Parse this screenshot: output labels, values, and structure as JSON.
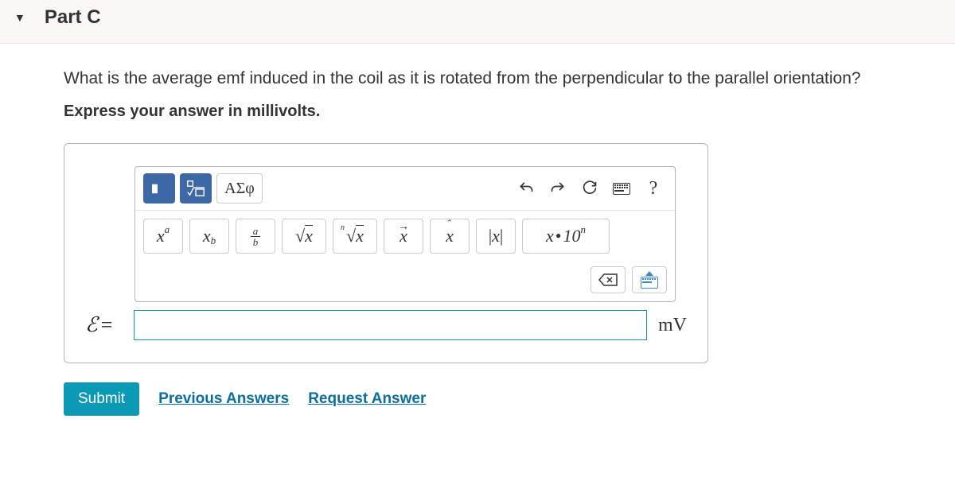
{
  "part_label": "Part C",
  "question": "What is the average emf induced in the coil as it is rotated from the perpendicular to the parallel orientation?",
  "instruction": "Express your answer in millivolts.",
  "toolbar": {
    "greek_label": "ΑΣφ",
    "help_label": "?",
    "buttons": {
      "superscript": {
        "base": "x",
        "exp": "a"
      },
      "subscript": {
        "base": "x",
        "sub": "b"
      },
      "fraction": {
        "num": "a",
        "den": "b"
      },
      "sqrt": "√x",
      "nroot": {
        "n": "n",
        "body": "√x"
      },
      "vector": "x",
      "hat": "x",
      "abs": "|x|",
      "sci": {
        "base": "x",
        "dot": "·",
        "ten": "10",
        "exp": "n"
      }
    }
  },
  "answer": {
    "var": "ℰ",
    "eq": "=",
    "value": "",
    "unit": "mV"
  },
  "actions": {
    "submit": "Submit",
    "previous": "Previous Answers",
    "request": "Request Answer"
  }
}
